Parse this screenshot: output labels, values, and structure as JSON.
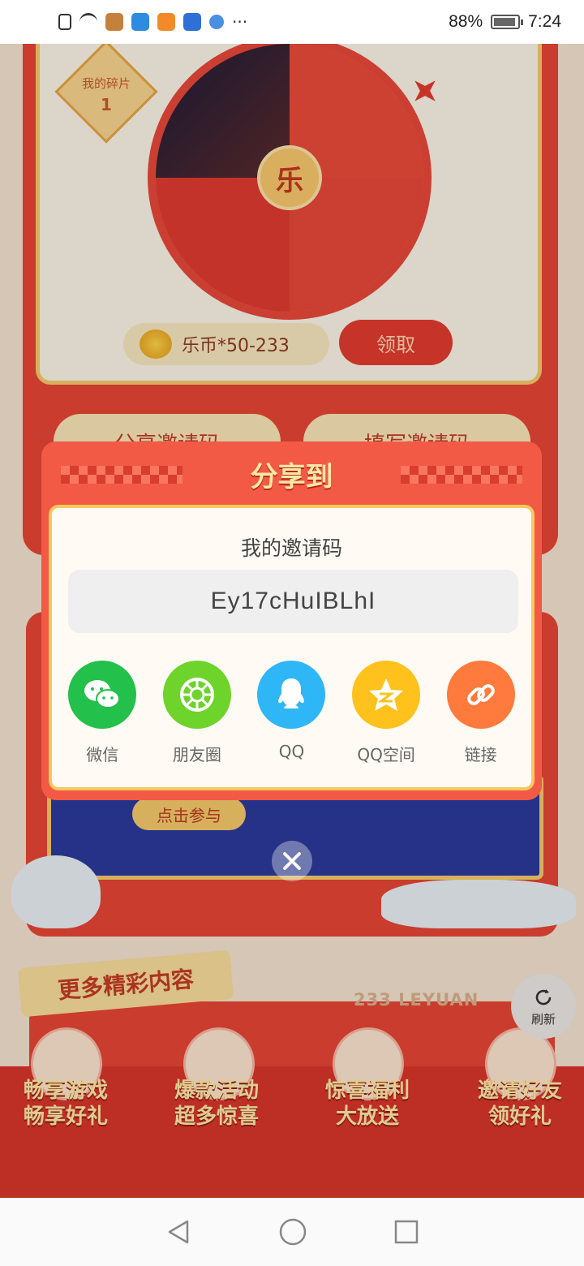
{
  "status_bar": {
    "battery": "88%",
    "time": "7:24"
  },
  "wheel": {
    "center_char": "乐",
    "fragment_label": "我的碎片",
    "fragment_count": "1"
  },
  "reward": {
    "text": "乐币*50-233",
    "claim_button": "领取"
  },
  "tabs": {
    "share_code": "分享邀请码",
    "enter_code": "填写邀请码"
  },
  "banner": {
    "cta": "点击参与"
  },
  "more": {
    "title": "更多精彩内容",
    "brand": "233 LEYUAN"
  },
  "promos": [
    {
      "line1": "畅享游戏",
      "line2": "畅享好礼"
    },
    {
      "line1": "爆款活动",
      "line2": "超多惊喜"
    },
    {
      "line1": "惊喜福利",
      "line2": "大放送"
    },
    {
      "line1": "邀请好友",
      "line2": "领好礼"
    }
  ],
  "refresh": {
    "label": "刷新"
  },
  "modal": {
    "title": "分享到",
    "code_label": "我的邀请码",
    "invite_code": "Ey17cHuIBLhI",
    "share_options": [
      {
        "label": "微信",
        "icon": "wechat-icon",
        "color": "#23c14b"
      },
      {
        "label": "朋友圈",
        "icon": "moments-icon",
        "color": "#6ed32b"
      },
      {
        "label": "QQ",
        "icon": "qq-icon",
        "color": "#2fb6f6"
      },
      {
        "label": "QQ空间",
        "icon": "qzone-icon",
        "color": "#ffc21d"
      },
      {
        "label": "链接",
        "icon": "link-icon",
        "color": "#ff7a3d"
      }
    ]
  },
  "colors": {
    "accent_red": "#f25a45",
    "gold": "#f7c85e"
  }
}
